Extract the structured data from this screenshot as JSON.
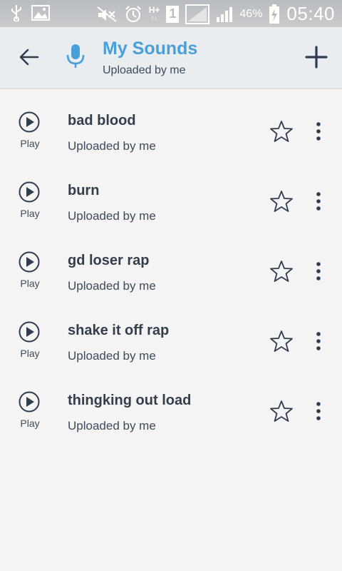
{
  "status_bar": {
    "battery": "46%",
    "time": "05:40",
    "network": "H+",
    "sim": "1",
    "icons": [
      "usb-icon",
      "image-icon",
      "mute-icon",
      "alarm-icon",
      "network-h-plus-icon",
      "sim-1-icon",
      "wifi-icon",
      "signal-icon",
      "battery-charging-icon"
    ]
  },
  "toolbar": {
    "title": "My Sounds",
    "subtitle": "Uploaded by me",
    "back_icon": "arrow-left-icon",
    "mic_icon": "microphone-icon",
    "add_icon": "plus-icon"
  },
  "colors": {
    "accent": "#4a9fd8",
    "text_dark": "#333d4b",
    "text_sub": "#3e4a5a",
    "toolbar_bg": "#e9edf0",
    "page_bg": "#f5f4f5"
  },
  "sounds": [
    {
      "title": "bad blood",
      "subtitle": "Uploaded by me",
      "play_label": "Play"
    },
    {
      "title": "burn",
      "subtitle": "Uploaded by me",
      "play_label": "Play"
    },
    {
      "title": "gd loser rap",
      "subtitle": "Uploaded by me",
      "play_label": "Play"
    },
    {
      "title": "shake it off rap",
      "subtitle": "Uploaded by me",
      "play_label": "Play"
    },
    {
      "title": "thingking out load",
      "subtitle": "Uploaded by me",
      "play_label": "Play"
    }
  ]
}
